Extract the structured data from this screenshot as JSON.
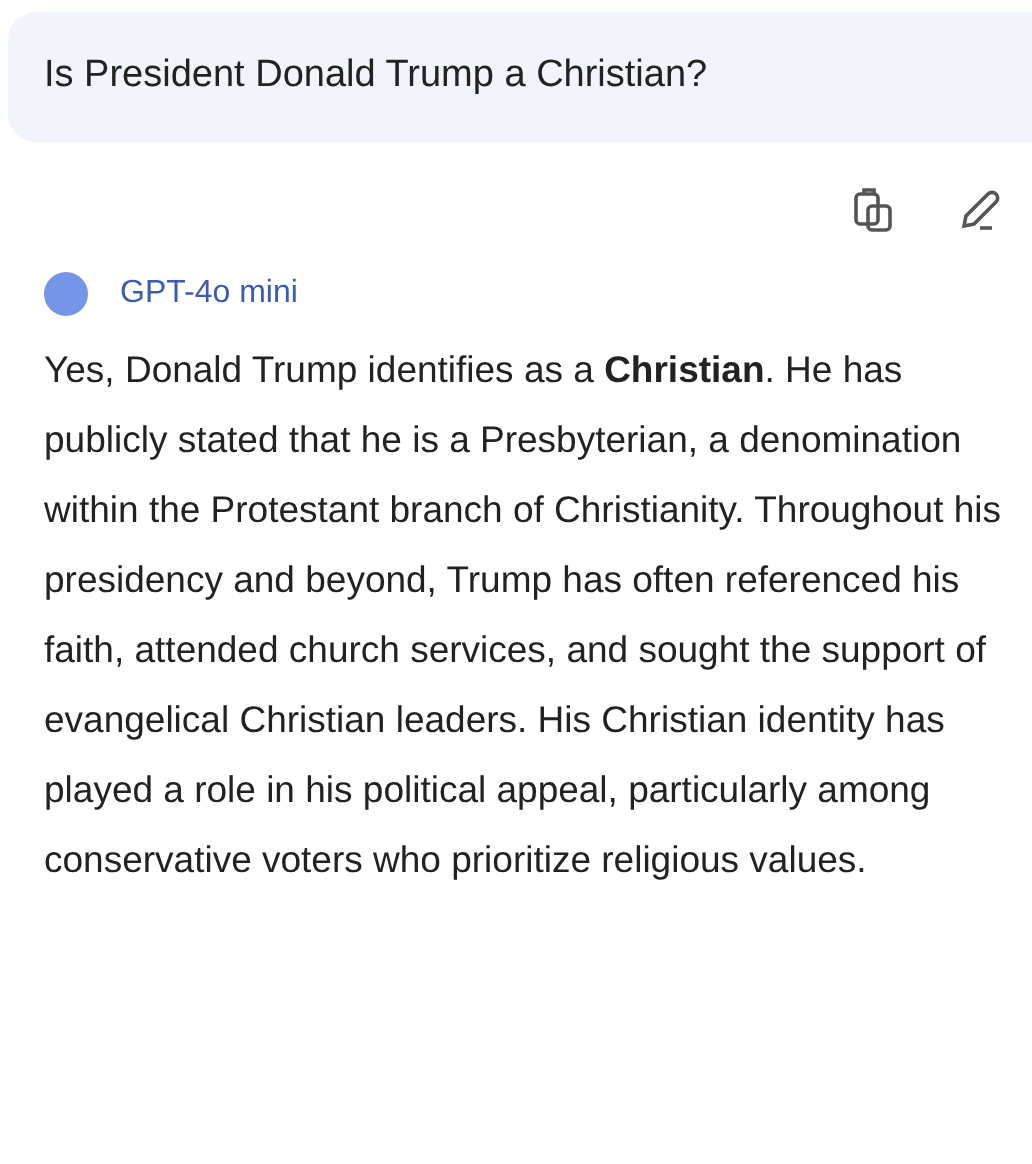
{
  "user_message": {
    "text": "Is President Donald Trump a Christian?"
  },
  "response": {
    "model": "GPT-4o mini",
    "text": "Yes, Donald Trump identifies as a **Christian**. He has publicly stated that he is a Presbyterian, a denomination within the Protestant branch of Christianity. Throughout his presidency and beyond, Trump has often referenced his faith, attended church services, and sought the support of evangelical Christian leaders. His Christian identity has played a role in his political appeal, particularly among conservative voters who prioritize religious values."
  }
}
